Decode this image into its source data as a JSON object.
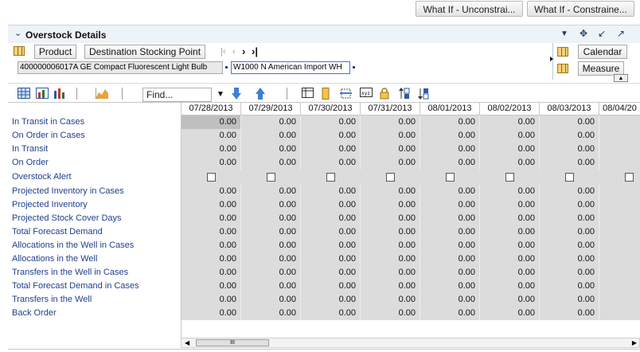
{
  "top_buttons": [
    "What If - Unconstrai...",
    "What If - Constraine..."
  ],
  "panel": {
    "title": "Overstock Details",
    "header_icons": [
      "dropdown-arrow-icon",
      "move-icon",
      "minimize-icon",
      "maximize-icon"
    ]
  },
  "dimensions": {
    "rows": [
      "Product",
      "Destination Stocking Point"
    ],
    "right": [
      "Calendar",
      "Measure"
    ]
  },
  "selection": {
    "product": "400000006017A GE Compact Fluorescent Light Bulb",
    "location": "W1000 N American Import WH"
  },
  "toolbar": {
    "find_placeholder": "Find...",
    "icons": [
      "table-view-icon",
      "chart-view-icon",
      "bar-chart-icon",
      "area-chart-icon",
      "down-arrow-icon",
      "up-arrow-icon",
      "grid-icon",
      "highlight-icon",
      "hide-icon",
      "xyz-icon",
      "lock-icon",
      "sort-ascending-icon",
      "sort-descending-icon"
    ]
  },
  "grid": {
    "columns": [
      "07/28/2013",
      "07/29/2013",
      "07/30/2013",
      "07/31/2013",
      "08/01/2013",
      "08/02/2013",
      "08/03/2013",
      "08/04/20"
    ],
    "rows": [
      {
        "label": "In Transit in Cases",
        "type": "value",
        "values": [
          "0.00",
          "0.00",
          "0.00",
          "0.00",
          "0.00",
          "0.00",
          "0.00"
        ]
      },
      {
        "label": "On Order in Cases",
        "type": "value",
        "values": [
          "0.00",
          "0.00",
          "0.00",
          "0.00",
          "0.00",
          "0.00",
          "0.00"
        ]
      },
      {
        "label": "In Transit",
        "type": "value",
        "values": [
          "0.00",
          "0.00",
          "0.00",
          "0.00",
          "0.00",
          "0.00",
          "0.00"
        ]
      },
      {
        "label": "On Order",
        "type": "value",
        "values": [
          "0.00",
          "0.00",
          "0.00",
          "0.00",
          "0.00",
          "0.00",
          "0.00"
        ]
      },
      {
        "label": "Overstock Alert",
        "type": "checkbox",
        "values": []
      },
      {
        "label": "Projected Inventory in Cases",
        "type": "value",
        "values": [
          "0.00",
          "0.00",
          "0.00",
          "0.00",
          "0.00",
          "0.00",
          "0.00"
        ]
      },
      {
        "label": "Projected Inventory",
        "type": "value",
        "values": [
          "0.00",
          "0.00",
          "0.00",
          "0.00",
          "0.00",
          "0.00",
          "0.00"
        ]
      },
      {
        "label": "Projected Stock Cover Days",
        "type": "value",
        "values": [
          "0.00",
          "0.00",
          "0.00",
          "0.00",
          "0.00",
          "0.00",
          "0.00"
        ]
      },
      {
        "label": "Total Forecast Demand",
        "type": "value",
        "values": [
          "0.00",
          "0.00",
          "0.00",
          "0.00",
          "0.00",
          "0.00",
          "0.00"
        ]
      },
      {
        "label": "Allocations in the Well in Cases",
        "type": "value",
        "values": [
          "0.00",
          "0.00",
          "0.00",
          "0.00",
          "0.00",
          "0.00",
          "0.00"
        ]
      },
      {
        "label": "Allocations in the Well",
        "type": "value",
        "values": [
          "0.00",
          "0.00",
          "0.00",
          "0.00",
          "0.00",
          "0.00",
          "0.00"
        ]
      },
      {
        "label": "Transfers in the Well in Cases",
        "type": "value",
        "values": [
          "0.00",
          "0.00",
          "0.00",
          "0.00",
          "0.00",
          "0.00",
          "0.00"
        ]
      },
      {
        "label": "Total Forecast Demand in Cases",
        "type": "value",
        "values": [
          "0.00",
          "0.00",
          "0.00",
          "0.00",
          "0.00",
          "0.00",
          "0.00"
        ]
      },
      {
        "label": "Transfers in the Well",
        "type": "value",
        "values": [
          "0.00",
          "0.00",
          "0.00",
          "0.00",
          "0.00",
          "0.00",
          "0.00"
        ]
      },
      {
        "label": "Back Order",
        "type": "value",
        "values": [
          "0.00",
          "0.00",
          "0.00",
          "0.00",
          "0.00",
          "0.00",
          "0.00"
        ]
      }
    ]
  },
  "scrollbar": {
    "thumb_glyph": "III"
  }
}
